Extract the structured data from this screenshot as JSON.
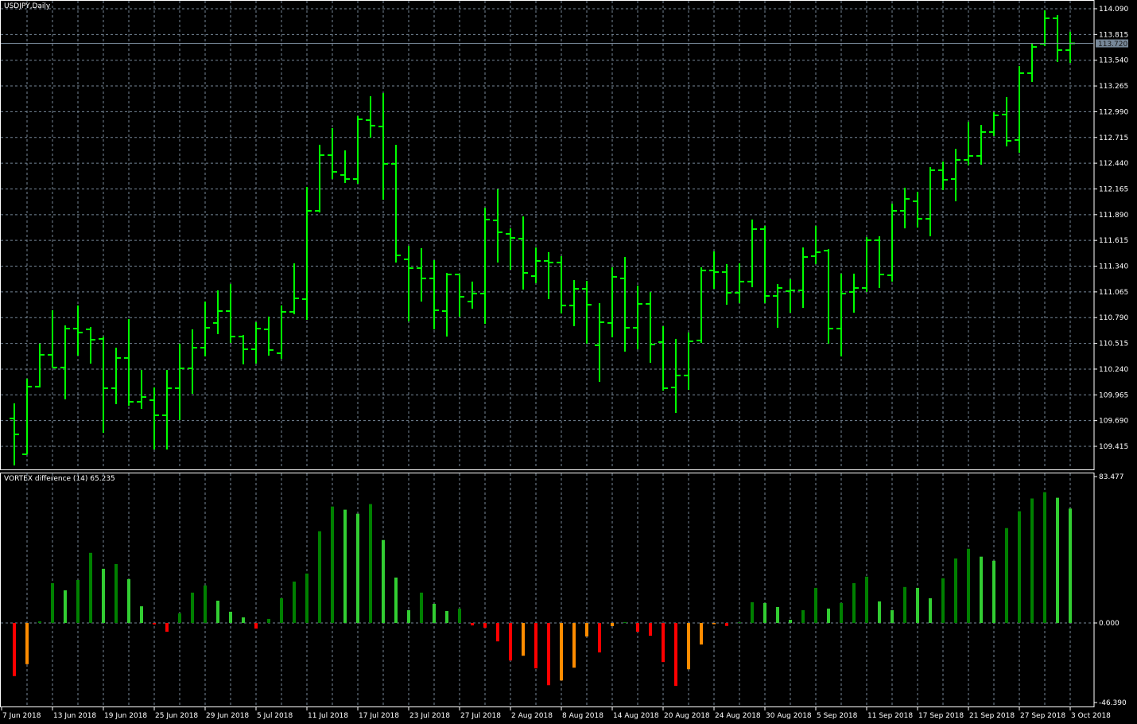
{
  "header": {
    "symbol_title": "USDJPY,Daily"
  },
  "indicator": {
    "name": "VORTEX difference (14)",
    "value": "65.235"
  },
  "colors": {
    "background": "#000000",
    "bar": "#00FF00",
    "grid": "#778899",
    "axis": "#FFFFFF",
    "price_line": "#778899",
    "hist_up_rising": "#008000",
    "hist_up_falling": "#32CD32",
    "hist_down_falling": "#FF0000",
    "hist_down_rising": "#FF8C00"
  },
  "chart_data": [
    {
      "type": "ohlc",
      "title": "USDJPY,Daily",
      "ylim": [
        109.2,
        114.18
      ],
      "y_ticks": [
        "114.090",
        "113.815",
        "113.540",
        "113.265",
        "112.990",
        "112.715",
        "112.440",
        "112.165",
        "111.890",
        "111.615",
        "111.340",
        "111.065",
        "110.790",
        "110.515",
        "110.240",
        "109.965",
        "109.690",
        "109.415"
      ],
      "current_price": "113.720",
      "x_ticks": [
        "7 Jun 2018",
        "13 Jun 2018",
        "19 Jun 2018",
        "25 Jun 2018",
        "29 Jun 2018",
        "5 Jul 2018",
        "11 Jul 2018",
        "17 Jul 2018",
        "23 Jul 2018",
        "27 Jul 2018",
        "2 Aug 2018",
        "8 Aug 2018",
        "14 Aug 2018",
        "20 Aug 2018",
        "24 Aug 2018",
        "30 Aug 2018",
        "5 Sep 2018",
        "11 Sep 2018",
        "17 Sep 2018",
        "21 Sep 2018",
        "27 Sep 2018",
        "3 Oct 2018"
      ],
      "ohlc_fields": [
        "open",
        "high",
        "low",
        "close"
      ],
      "ohlc": [
        [
          109.713,
          109.874,
          109.211,
          109.543
        ],
        [
          109.33,
          110.138,
          109.33,
          110.053
        ],
        [
          110.053,
          110.512,
          110.044,
          110.393
        ],
        [
          110.393,
          110.869,
          110.257,
          110.257
        ],
        [
          110.257,
          110.707,
          109.917,
          110.673
        ],
        [
          110.673,
          110.92,
          110.384,
          110.631
        ],
        [
          110.665,
          110.69,
          110.299,
          110.554
        ],
        [
          110.563,
          110.588,
          109.56,
          110.036
        ],
        [
          110.036,
          110.469,
          109.866,
          110.359
        ],
        [
          110.359,
          110.775,
          109.849,
          109.891
        ],
        [
          109.891,
          110.231,
          109.815,
          109.942
        ],
        [
          109.908,
          110.044,
          109.381,
          109.747
        ],
        [
          109.747,
          110.231,
          109.381,
          110.036
        ],
        [
          110.036,
          110.512,
          109.696,
          110.248
        ],
        [
          110.248,
          110.665,
          109.976,
          110.469
        ],
        [
          110.469,
          110.962,
          110.376,
          110.682
        ],
        [
          110.733,
          111.081,
          110.614,
          110.86
        ],
        [
          110.86,
          111.149,
          110.52,
          110.588
        ],
        [
          110.588,
          110.605,
          110.291,
          110.452
        ],
        [
          110.452,
          110.741,
          110.299,
          110.673
        ],
        [
          110.665,
          110.801,
          110.384,
          110.444
        ],
        [
          110.41,
          110.92,
          110.35,
          110.852
        ],
        [
          110.852,
          111.37,
          110.826,
          110.996
        ],
        [
          110.988,
          112.186,
          110.767,
          111.931
        ],
        [
          111.931,
          112.637,
          111.914,
          112.526
        ],
        [
          112.526,
          112.815,
          112.271,
          112.348
        ],
        [
          112.314,
          112.577,
          112.229,
          112.271
        ],
        [
          112.271,
          112.943,
          112.22,
          112.909
        ],
        [
          112.9,
          113.155,
          112.713,
          112.841
        ],
        [
          112.832,
          113.189,
          112.05,
          112.433
        ],
        [
          112.433,
          112.637,
          111.379,
          111.455
        ],
        [
          111.413,
          111.557,
          110.75,
          111.319
        ],
        [
          111.319,
          111.532,
          110.962,
          111.209
        ],
        [
          111.209,
          111.404,
          110.665,
          110.869
        ],
        [
          110.86,
          111.268,
          110.588,
          111.251
        ],
        [
          111.251,
          111.251,
          110.801,
          111.013
        ],
        [
          110.962,
          111.175,
          110.886,
          111.047
        ],
        [
          111.047,
          111.965,
          110.724,
          111.838
        ],
        [
          111.829,
          112.161,
          111.379,
          111.702
        ],
        [
          111.685,
          111.744,
          111.302,
          111.642
        ],
        [
          111.634,
          111.872,
          111.09,
          111.268
        ],
        [
          111.234,
          111.54,
          111.158,
          111.396
        ],
        [
          111.396,
          111.489,
          110.988,
          111.379
        ],
        [
          111.379,
          111.447,
          110.835,
          110.92
        ],
        [
          110.92,
          111.192,
          110.699,
          111.098
        ],
        [
          111.098,
          111.183,
          110.512,
          110.928
        ],
        [
          110.495,
          110.945,
          110.104,
          110.741
        ],
        [
          110.733,
          111.328,
          110.58,
          111.226
        ],
        [
          111.209,
          111.438,
          110.427,
          110.682
        ],
        [
          110.682,
          111.132,
          110.452,
          110.937
        ],
        [
          110.937,
          111.064,
          110.308,
          110.503
        ],
        [
          110.529,
          110.699,
          110.01,
          110.036
        ],
        [
          110.044,
          110.563,
          109.772,
          110.172
        ],
        [
          110.172,
          110.631,
          110.019,
          110.537
        ],
        [
          110.546,
          111.328,
          110.52,
          111.294
        ],
        [
          111.294,
          111.498,
          111.098,
          111.277
        ],
        [
          111.277,
          111.362,
          110.928,
          111.056
        ],
        [
          111.056,
          111.37,
          110.945,
          111.175
        ],
        [
          111.175,
          111.838,
          111.115,
          111.736
        ],
        [
          111.736,
          111.77,
          110.945,
          111.022
        ],
        [
          111.022,
          111.149,
          110.682,
          111.107
        ],
        [
          111.073,
          111.2,
          110.843,
          111.081
        ],
        [
          111.081,
          111.54,
          110.894,
          111.438
        ],
        [
          111.447,
          111.77,
          111.362,
          111.489
        ],
        [
          111.506,
          111.523,
          110.512,
          110.673
        ],
        [
          110.673,
          111.26,
          110.376,
          111.047
        ],
        [
          111.064,
          111.26,
          110.843,
          111.107
        ],
        [
          111.107,
          111.651,
          111.064,
          111.617
        ],
        [
          111.617,
          111.659,
          111.107,
          111.251
        ],
        [
          111.243,
          112.008,
          111.175,
          111.931
        ],
        [
          111.931,
          112.178,
          111.744,
          112.059
        ],
        [
          112.033,
          112.135,
          111.753,
          111.846
        ],
        [
          111.846,
          112.399,
          111.659,
          112.365
        ],
        [
          112.365,
          112.458,
          112.152,
          112.263
        ],
        [
          112.271,
          112.594,
          112.033,
          112.475
        ],
        [
          112.475,
          112.883,
          112.416,
          112.518
        ],
        [
          112.518,
          112.849,
          112.424,
          112.773
        ],
        [
          112.773,
          112.985,
          112.73,
          112.951
        ],
        [
          112.96,
          113.147,
          112.62,
          112.679
        ],
        [
          112.688,
          113.478,
          112.552,
          113.402
        ],
        [
          113.402,
          113.725,
          113.308,
          113.682
        ],
        [
          113.716,
          114.073,
          113.691,
          113.988
        ],
        [
          113.988,
          114.022,
          113.521,
          113.648
        ],
        [
          113.648,
          113.844,
          113.512,
          113.72
        ]
      ]
    },
    {
      "type": "bar",
      "title": "VORTEX difference (14)",
      "ylim": [
        -46.39,
        83.477
      ],
      "y_ticks": [
        "83.477",
        "0.000",
        "-46.390"
      ],
      "values": [
        -30.3,
        -23.5,
        0.9,
        22.7,
        18.6,
        24.5,
        40.0,
        30.9,
        33.6,
        25.0,
        9.5,
        -0.8,
        -5.0,
        5.5,
        17.3,
        21.4,
        12.7,
        6.4,
        3.2,
        -3.2,
        2.3,
        14.1,
        23.6,
        28.2,
        52.3,
        66.4,
        64.6,
        62.3,
        67.8,
        47.3,
        25.9,
        7.3,
        17.3,
        10.9,
        6.8,
        8.2,
        -1.4,
        -2.7,
        -10.5,
        -21.4,
        -18.7,
        -25.9,
        -35.5,
        -32.8,
        -25.5,
        -7.7,
        -16.8,
        -1.8,
        0.5,
        -5.0,
        -7.3,
        -22.3,
        -35.9,
        -26.4,
        -12.3,
        -0.7,
        -1.7,
        0.4,
        11.8,
        11.4,
        9.1,
        1.8,
        7.3,
        20.0,
        8.2,
        11.4,
        22.7,
        26.4,
        12.3,
        7.3,
        20.5,
        20.0,
        14.1,
        25.5,
        36.8,
        42.3,
        37.8,
        35.5,
        54.1,
        63.7,
        71.0,
        74.6,
        71.4,
        65.235
      ],
      "color_keys": "RODDLDDLDLLRRDDDLLLRDDDDDDLLDLLLDLLDRRRRORROOOROD RRRROOORDDLLLDDLDDDLLDLLDDDLLDDDDLL"
    }
  ]
}
